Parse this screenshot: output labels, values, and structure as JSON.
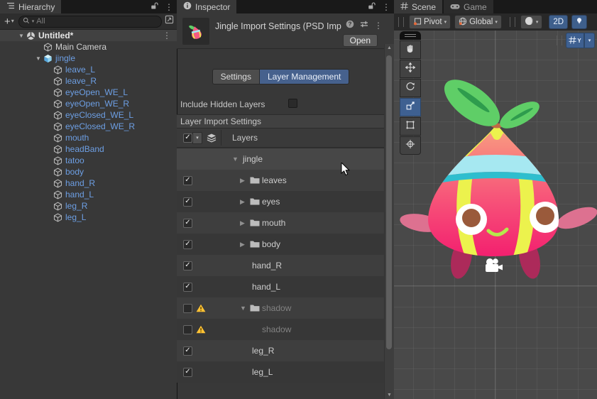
{
  "hierarchy": {
    "tab_label": "Hierarchy",
    "add_button": "+",
    "search_placeholder": "All",
    "scene_row_label": "Untitled*",
    "items": [
      {
        "label": "Main Camera",
        "level": 1,
        "icon": "cube",
        "blue": false,
        "arrow": ""
      },
      {
        "label": "jingle",
        "level": 1,
        "icon": "prefab",
        "blue": true,
        "arrow": "▼"
      },
      {
        "label": "leave_L",
        "level": 2,
        "icon": "cube",
        "blue": true,
        "arrow": ""
      },
      {
        "label": "leave_R",
        "level": 2,
        "icon": "cube",
        "blue": true,
        "arrow": ""
      },
      {
        "label": "eyeOpen_WE_L",
        "level": 2,
        "icon": "cube",
        "blue": true,
        "arrow": ""
      },
      {
        "label": "eyeOpen_WE_R",
        "level": 2,
        "icon": "cube",
        "blue": true,
        "arrow": ""
      },
      {
        "label": "eyeClosed_WE_L",
        "level": 2,
        "icon": "cube",
        "blue": true,
        "arrow": ""
      },
      {
        "label": "eyeClosed_WE_R",
        "level": 2,
        "icon": "cube",
        "blue": true,
        "arrow": ""
      },
      {
        "label": "mouth",
        "level": 2,
        "icon": "cube",
        "blue": true,
        "arrow": ""
      },
      {
        "label": "headBand",
        "level": 2,
        "icon": "cube",
        "blue": true,
        "arrow": ""
      },
      {
        "label": "tatoo",
        "level": 2,
        "icon": "cube",
        "blue": true,
        "arrow": ""
      },
      {
        "label": "body",
        "level": 2,
        "icon": "cube",
        "blue": true,
        "arrow": ""
      },
      {
        "label": "hand_R",
        "level": 2,
        "icon": "cube",
        "blue": true,
        "arrow": ""
      },
      {
        "label": "hand_L",
        "level": 2,
        "icon": "cube",
        "blue": true,
        "arrow": ""
      },
      {
        "label": "leg_R",
        "level": 2,
        "icon": "cube",
        "blue": true,
        "arrow": ""
      },
      {
        "label": "leg_L",
        "level": 2,
        "icon": "cube",
        "blue": true,
        "arrow": ""
      }
    ]
  },
  "inspector": {
    "tab_label": "Inspector",
    "title": "Jingle Import Settings (PSD Imp",
    "open_label": "Open",
    "tab_settings": "Settings",
    "tab_layer_management": "Layer Management",
    "include_hidden_label": "Include Hidden Layers",
    "include_hidden_checked": false,
    "section_title": "Layer Import Settings",
    "layers_header": "Layers",
    "rows": [
      {
        "label": "jingle",
        "kind": "root",
        "checked": null,
        "warning": false,
        "arrow": "▼",
        "disabled": false
      },
      {
        "label": "leaves",
        "kind": "folder",
        "checked": true,
        "warning": false,
        "arrow": "▶",
        "disabled": false
      },
      {
        "label": "eyes",
        "kind": "folder",
        "checked": true,
        "warning": false,
        "arrow": "▶",
        "disabled": false
      },
      {
        "label": "mouth",
        "kind": "folder",
        "checked": true,
        "warning": false,
        "arrow": "▶",
        "disabled": false
      },
      {
        "label": "body",
        "kind": "folder",
        "checked": true,
        "warning": false,
        "arrow": "▶",
        "disabled": false
      },
      {
        "label": "hand_R",
        "kind": "layer",
        "checked": true,
        "warning": false,
        "arrow": "",
        "disabled": false
      },
      {
        "label": "hand_L",
        "kind": "layer",
        "checked": true,
        "warning": false,
        "arrow": "",
        "disabled": false
      },
      {
        "label": "shadow",
        "kind": "folder",
        "checked": false,
        "warning": true,
        "arrow": "▼",
        "disabled": true
      },
      {
        "label": "shadow",
        "kind": "sublayer",
        "checked": false,
        "warning": true,
        "arrow": "",
        "disabled": true
      },
      {
        "label": "leg_R",
        "kind": "layer",
        "checked": true,
        "warning": false,
        "arrow": "",
        "disabled": false
      },
      {
        "label": "leg_L",
        "kind": "layer",
        "checked": true,
        "warning": false,
        "arrow": "",
        "disabled": false
      }
    ]
  },
  "scene": {
    "tab_scene": "Scene",
    "tab_game": "Game",
    "pivot_label": "Pivot",
    "global_label": "Global",
    "mode_2d_label": "2D",
    "grid_axis_label": "Y",
    "tools": [
      "hand",
      "move",
      "rotate",
      "scale",
      "rect",
      "transform"
    ],
    "selected_tool": "scale"
  },
  "character": {
    "body_top": "#F8A181",
    "body_mid": "#F75579",
    "body_bottom": "#F3206F",
    "leaf": "#5FCE67",
    "leaf_vein": "#2E9C4D",
    "stem": "#C06A44",
    "stripe": "#ECF24D",
    "band": "#A6E8F1",
    "band_stripe": "#2EBECE",
    "arm": "#DD7190",
    "leg": "#AC2A5A",
    "eye_white": "#FFFFFF",
    "iris": "#9A5A3B",
    "smile": "#B5E94C",
    "camera_gizmo": "#FFFFFF"
  }
}
